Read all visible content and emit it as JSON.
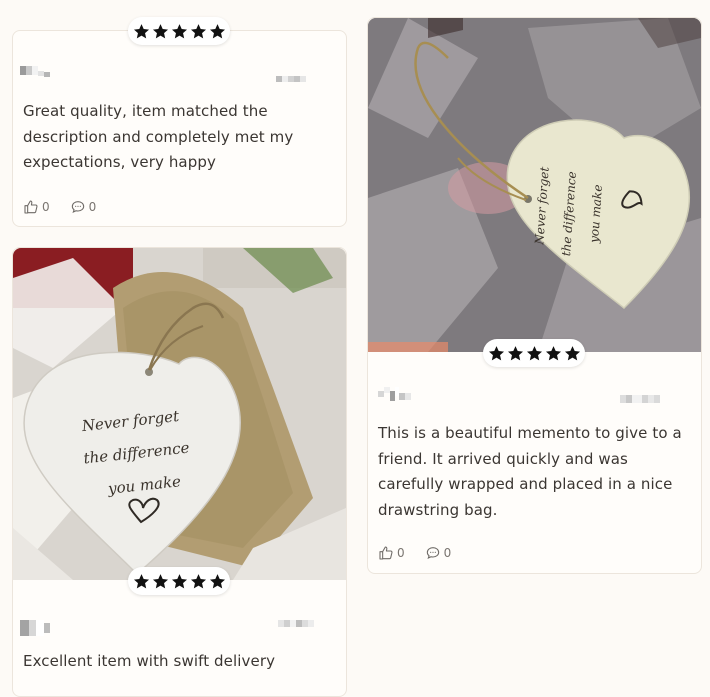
{
  "reviews": [
    {
      "rating": 5,
      "text": "Great quality, item matched the description and completely met my expectations, very happy",
      "likes": "0",
      "comments": "0",
      "has_photo": false
    },
    {
      "rating": 5,
      "text": "Excellent item with swift delivery",
      "has_photo": true,
      "photo_text": [
        "Never forget",
        "the difference",
        "you make"
      ]
    },
    {
      "rating": 5,
      "text": "This is a beautiful memento to give to a friend. It arrived quickly and was carefully wrapped and placed in a nice drawstring bag.",
      "likes": "0",
      "comments": "0",
      "has_photo": true,
      "photo_text": [
        "Never forget",
        "the difference",
        "you make"
      ]
    }
  ],
  "icons": {
    "rating": "star-icon",
    "like": "thumbs-up-icon",
    "comment": "comment-bubble-icon"
  },
  "colors": {
    "page_background": "#fdfaf6",
    "card_border": "#ece5dc",
    "star": "#111111",
    "text": "#3b3632",
    "meta": "#7a7570"
  }
}
